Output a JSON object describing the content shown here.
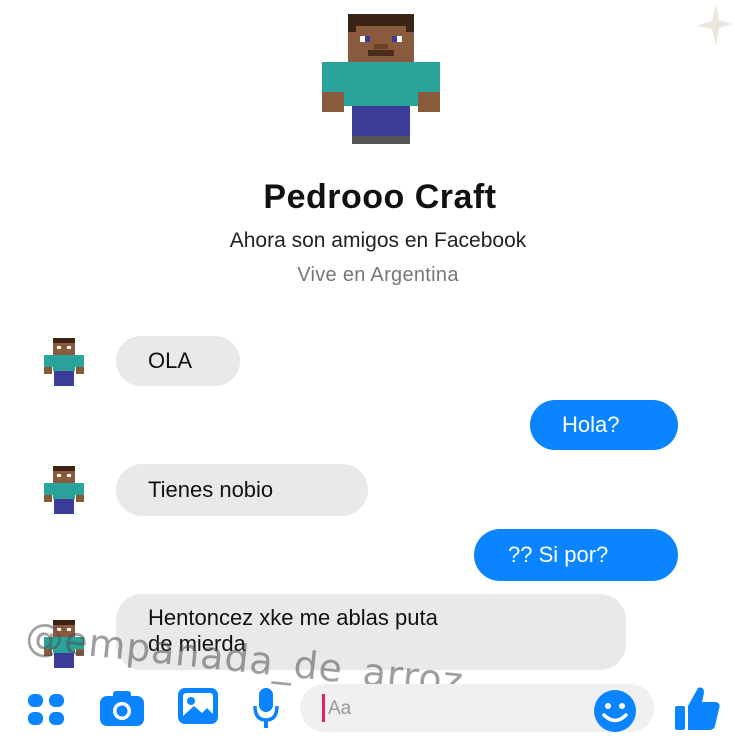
{
  "profile": {
    "name": "Pedrooo Craft",
    "friends_text": "Ahora son amigos en Facebook",
    "location": "Vive en Argentina"
  },
  "messages": [
    {
      "direction": "in",
      "text": "OLA"
    },
    {
      "direction": "out",
      "text": "Hola?"
    },
    {
      "direction": "in",
      "text": "Tienes nobio"
    },
    {
      "direction": "out",
      "text": "?? Si por?"
    },
    {
      "direction": "in",
      "text_lines": [
        "Hentoncez xke me ablas puta",
        "de mierda"
      ]
    }
  ],
  "composer": {
    "placeholder": "Aa",
    "icons": [
      "apps-icon",
      "camera-icon",
      "gallery-icon",
      "microphone-icon",
      "emoji-icon",
      "thumbs-up-icon"
    ]
  },
  "watermark": "@empanada_de_arroz",
  "colors": {
    "accent": "#0a84ff",
    "incoming_bubble": "#e9e9ec",
    "skin": "#8a5a3c",
    "shirt": "#2aa39a",
    "pants": "#3b3b98"
  }
}
